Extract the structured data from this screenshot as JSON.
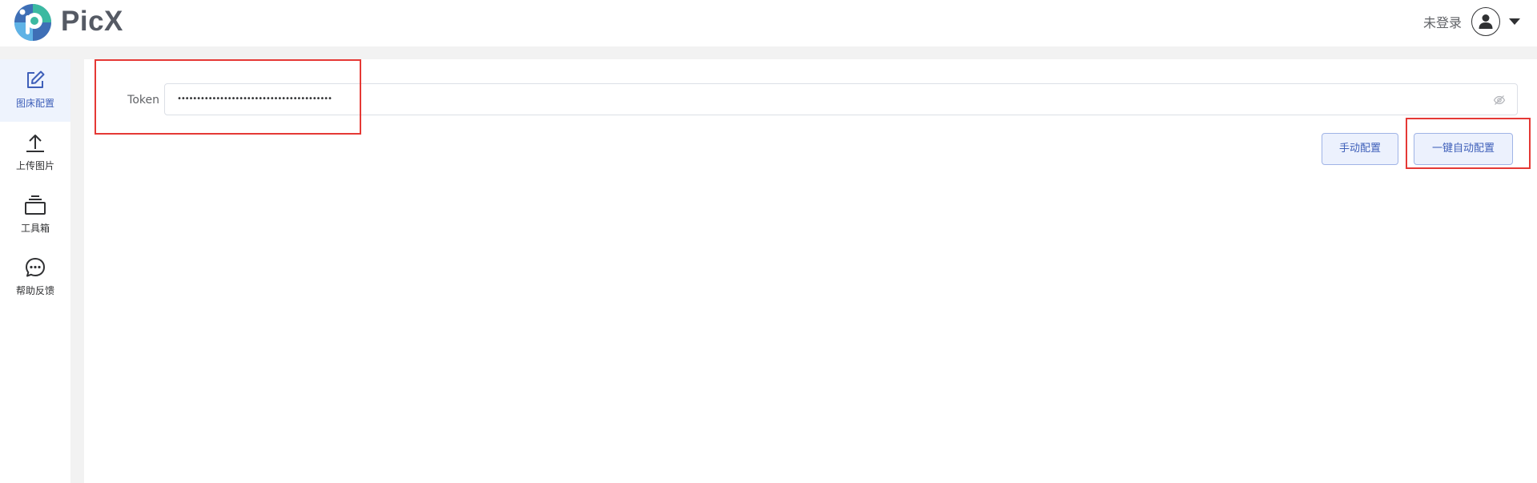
{
  "app": {
    "name": "PicX",
    "brand_colors": {
      "teal": "#3bb9a1",
      "blue": "#3e6fb6",
      "light_blue": "#5fb3e6",
      "accent": "#3e5fb9"
    }
  },
  "header": {
    "login_status": "未登录",
    "avatar_icon": "user-icon",
    "menu_icon": "caret-down-icon"
  },
  "sidebar": {
    "items": [
      {
        "label": "图床配置",
        "icon": "edit-icon",
        "active": true
      },
      {
        "label": "上传图片",
        "icon": "upload-icon",
        "active": false
      },
      {
        "label": "工具箱",
        "icon": "toolbox-icon",
        "active": false
      },
      {
        "label": "帮助反馈",
        "icon": "chat-bubble-icon",
        "active": false
      }
    ]
  },
  "main": {
    "token_label": "Token",
    "token_value": "••••••••••••••••••••••••••••••••••••••••",
    "token_toggle_icon": "eye-off-icon",
    "manual_config_button": "手动配置",
    "auto_config_button": "一键自动配置"
  },
  "annotations": {
    "highlight_color": "#e53935",
    "highlighted": [
      "token-field",
      "auto-config-button"
    ]
  }
}
